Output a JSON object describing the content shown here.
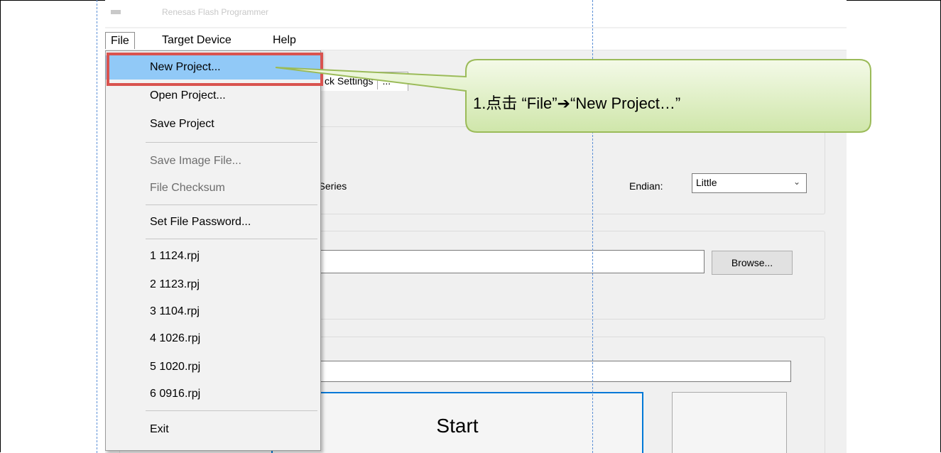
{
  "window": {
    "title": "Renesas Flash Programmer"
  },
  "menubar": {
    "file": "File",
    "target_device": "Target Device",
    "help": "Help"
  },
  "tabs": {
    "tab_1": "ck Settings",
    "tab_2": "..."
  },
  "project": {
    "file_fragment": "pj",
    "series_fragment": ") Series",
    "endian_label": "Endian:",
    "endian_value": "Little"
  },
  "program_file": {
    "browse_label": "Browse..."
  },
  "start": {
    "label": "Start"
  },
  "file_menu": {
    "items": [
      {
        "label": "New Project...",
        "enabled": true,
        "highlighted": true
      },
      {
        "label": "Open Project...",
        "enabled": true
      },
      {
        "label": "Save Project",
        "enabled": true
      },
      {
        "label": "Save Image File...",
        "enabled": false
      },
      {
        "label": "File Checksum",
        "enabled": false
      },
      {
        "label": "Set File Password...",
        "enabled": true
      },
      {
        "label": "1 1124.rpj",
        "enabled": true
      },
      {
        "label": "2 1123.rpj",
        "enabled": true
      },
      {
        "label": "3 1104.rpj",
        "enabled": true
      },
      {
        "label": "4 1026.rpj",
        "enabled": true
      },
      {
        "label": "5 1020.rpj",
        "enabled": true
      },
      {
        "label": "6 0916.rpj",
        "enabled": true
      },
      {
        "label": "Exit",
        "enabled": true
      }
    ]
  },
  "annotation": {
    "text": "1.点击 “File”➔“New Project…”"
  },
  "colors": {
    "highlight": "#91c9f7",
    "annotation_border": "#d9534f",
    "callout_fill": "#dcefc2",
    "accent": "#0078d7"
  }
}
